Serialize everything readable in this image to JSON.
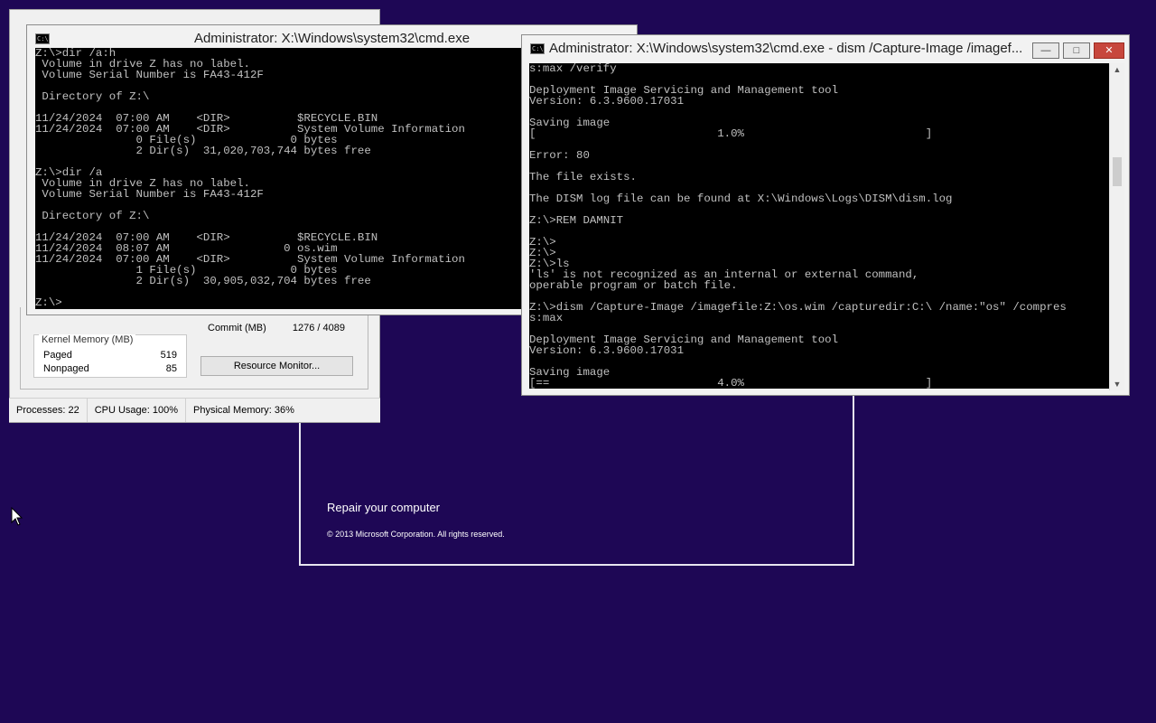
{
  "setup": {
    "repair_label": "Repair your computer",
    "copyright": "© 2013 Microsoft Corporation. All rights reserved."
  },
  "taskmgr": {
    "kernel_memory_title": "Kernel Memory (MB)",
    "paged_label": "Paged",
    "paged_value": "519",
    "nonpaged_label": "Nonpaged",
    "nonpaged_value": "85",
    "commit_label": "Commit (MB)",
    "commit_value": "1276 / 4089",
    "resource_monitor_button": "Resource Monitor...",
    "status_processes": "Processes: 22",
    "status_cpu": "CPU Usage: 100%",
    "status_memory": "Physical Memory: 36%"
  },
  "cmd1": {
    "title": "Administrator: X:\\Windows\\system32\\cmd.exe",
    "lines": [
      "Z:\\>dir /a:h",
      " Volume in drive Z has no label.",
      " Volume Serial Number is FA43-412F",
      "",
      " Directory of Z:\\",
      "",
      "11/24/2024  07:00 AM    <DIR>          $RECYCLE.BIN",
      "11/24/2024  07:00 AM    <DIR>          System Volume Information",
      "               0 File(s)              0 bytes",
      "               2 Dir(s)  31,020,703,744 bytes free",
      "",
      "Z:\\>dir /a",
      " Volume in drive Z has no label.",
      " Volume Serial Number is FA43-412F",
      "",
      " Directory of Z:\\",
      "",
      "11/24/2024  07:00 AM    <DIR>          $RECYCLE.BIN",
      "11/24/2024  08:07 AM                 0 os.wim",
      "11/24/2024  07:00 AM    <DIR>          System Volume Information",
      "               1 File(s)              0 bytes",
      "               2 Dir(s)  30,905,032,704 bytes free",
      "",
      "Z:\\>"
    ]
  },
  "cmd2": {
    "title": "Administrator: X:\\Windows\\system32\\cmd.exe - dism  /Capture-Image /imagef...",
    "lines": [
      "s:max /verify",
      "",
      "Deployment Image Servicing and Management tool",
      "Version: 6.3.9600.17031",
      "",
      "Saving image",
      "[                           1.0%                           ]",
      "",
      "Error: 80",
      "",
      "The file exists.",
      "",
      "The DISM log file can be found at X:\\Windows\\Logs\\DISM\\dism.log",
      "",
      "Z:\\>REM DAMNIT",
      "",
      "Z:\\>",
      "Z:\\>",
      "Z:\\>ls",
      "'ls' is not recognized as an internal or external command,",
      "operable program or batch file.",
      "",
      "Z:\\>dism /Capture-Image /imagefile:Z:\\os.wim /capturedir:C:\\ /name:\"os\" /compres",
      "s:max",
      "",
      "Deployment Image Servicing and Management tool",
      "Version: 6.3.9600.17031",
      "",
      "Saving image",
      "[==                         4.0%                           ]"
    ]
  }
}
